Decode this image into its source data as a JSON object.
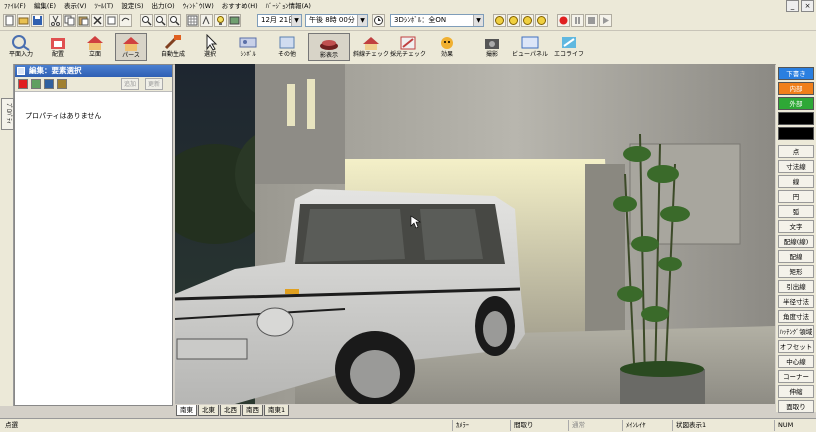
{
  "menu": [
    "ﾌｧｲﾙ(F)",
    "編集(E)",
    "表示(V)",
    "ﾂｰﾙ(T)",
    "設定(S)",
    "出力(O)",
    "ｳｨﾝﾄﾞｳ(W)",
    "おすすめ(H)",
    "ﾊﾞｰｼﾞｮﾝ情報(A)"
  ],
  "toolbar1": {
    "date_value": "12月 21日",
    "time_value": "午後 8時 00分",
    "symbol_value": "3Dｼﾝﾎﾞﾙ：全ON"
  },
  "toolbar2": [
    {
      "label": "平面入力",
      "icon": "plan-input-icon",
      "color": "#4a6fb0"
    },
    {
      "label": "配置",
      "icon": "place-icon",
      "color": "#c03030"
    },
    {
      "label": "立面",
      "icon": "elevation-icon",
      "color": "#d04040"
    },
    {
      "label": "パース",
      "icon": "perspective-icon",
      "color": "#d04040"
    },
    {
      "label": "自動生成",
      "icon": "auto-generate-icon",
      "color": "#e06020"
    },
    {
      "label": "選択",
      "icon": "select-icon",
      "color": "#444444"
    },
    {
      "label": "ｼﾝﾎﾞﾙ",
      "icon": "symbol-icon",
      "color": "#5a6fa8"
    },
    {
      "label": "その他",
      "icon": "other-icon",
      "color": "#5a7fb0"
    },
    {
      "label": "影表示",
      "icon": "shadow-icon",
      "color": "#a03030"
    },
    {
      "label": "斜線チェック",
      "icon": "slope-check-icon",
      "color": "#c04040"
    },
    {
      "label": "採光チェック",
      "icon": "lighting-check-icon",
      "color": "#c04040"
    },
    {
      "label": "効果",
      "icon": "effect-icon",
      "color": "#e0a020"
    },
    {
      "label": "撮影",
      "icon": "camera-icon",
      "color": "#444444"
    },
    {
      "label": "ビューパネル",
      "icon": "view-panel-icon",
      "color": "#4070c0"
    },
    {
      "label": "エコライフ",
      "icon": "eco-life-icon",
      "color": "#40a0d0"
    }
  ],
  "panel": {
    "title": "編集：要素選択",
    "add_label": "追加",
    "update_label": "更新",
    "empty_message": "プロパティはありません",
    "side_tab": "ﾌﾟﾛﾊﾟﾃｨ"
  },
  "view_tabs": [
    "南東",
    "北東",
    "北西",
    "南西",
    "南東1"
  ],
  "palette": {
    "colors": [
      {
        "label": "下書き",
        "bg": "#2a7fe0",
        "fg": "#ffffff"
      },
      {
        "label": "内部",
        "bg": "#f07f1a",
        "fg": "#ffffff"
      },
      {
        "label": "外部",
        "bg": "#2ea836",
        "fg": "#ffffff"
      },
      {
        "label": "",
        "bg": "#000000",
        "fg": "#ffffff"
      },
      {
        "label": "",
        "bg": "#000000",
        "fg": "#ffffff"
      }
    ],
    "tools": [
      "点",
      "寸法線",
      "線",
      "円",
      "弧",
      "文字",
      "配線(線)",
      "配線",
      "矩形",
      "引出線",
      "半径寸法",
      "角度寸法",
      "ﾊｯﾁﾝｸﾞ領域",
      "オフセット",
      "中心線",
      "コーナー",
      "伸縮",
      "面取り"
    ]
  },
  "status": {
    "left": "点選",
    "camera": "ｶﾒﾗｰ",
    "pick": "間取り",
    "layer": "通常",
    "main_layer": "ﾒｲﾝﾚｲﾔ",
    "state": "状図表示1",
    "num": "NUM"
  }
}
